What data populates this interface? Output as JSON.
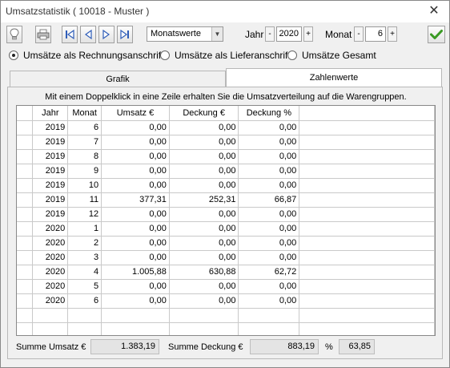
{
  "window": {
    "title": "Umsatzstatistik ( 10018 - Muster )",
    "close": "✕"
  },
  "toolbar": {
    "mode": "Monatswerte",
    "year_label": "Jahr",
    "year_value": "2020",
    "month_label": "Monat",
    "month_value": "6",
    "minus": "-",
    "plus": "+"
  },
  "radios": [
    {
      "label": "Umsätze als Rechnungsanschrift",
      "selected": true
    },
    {
      "label": "Umsätze als Lieferanschrift",
      "selected": false
    },
    {
      "label": "Umsätze Gesamt",
      "selected": false
    }
  ],
  "tabs": [
    {
      "label": "Grafik",
      "active": false
    },
    {
      "label": "Zahlenwerte",
      "active": true
    }
  ],
  "hint": "Mit einem Doppelklick in eine Zeile erhalten Sie die Umsatzverteilung auf die Warengruppen.",
  "table": {
    "headers": [
      "Jahr",
      "Monat",
      "Umsatz €",
      "Deckung €",
      "Deckung %"
    ],
    "rows": [
      [
        "2019",
        "6",
        "0,00",
        "0,00",
        "0,00"
      ],
      [
        "2019",
        "7",
        "0,00",
        "0,00",
        "0,00"
      ],
      [
        "2019",
        "8",
        "0,00",
        "0,00",
        "0,00"
      ],
      [
        "2019",
        "9",
        "0,00",
        "0,00",
        "0,00"
      ],
      [
        "2019",
        "10",
        "0,00",
        "0,00",
        "0,00"
      ],
      [
        "2019",
        "11",
        "377,31",
        "252,31",
        "66,87"
      ],
      [
        "2019",
        "12",
        "0,00",
        "0,00",
        "0,00"
      ],
      [
        "2020",
        "1",
        "0,00",
        "0,00",
        "0,00"
      ],
      [
        "2020",
        "2",
        "0,00",
        "0,00",
        "0,00"
      ],
      [
        "2020",
        "3",
        "0,00",
        "0,00",
        "0,00"
      ],
      [
        "2020",
        "4",
        "1.005,88",
        "630,88",
        "62,72"
      ],
      [
        "2020",
        "5",
        "0,00",
        "0,00",
        "0,00"
      ],
      [
        "2020",
        "6",
        "0,00",
        "0,00",
        "0,00"
      ]
    ]
  },
  "totals": {
    "umsatz_label": "Summe Umsatz €",
    "umsatz_value": "1.383,19",
    "deckung_label": "Summe Deckung €",
    "deckung_value": "883,19",
    "percent_label": "%",
    "percent_value": "63,85"
  }
}
